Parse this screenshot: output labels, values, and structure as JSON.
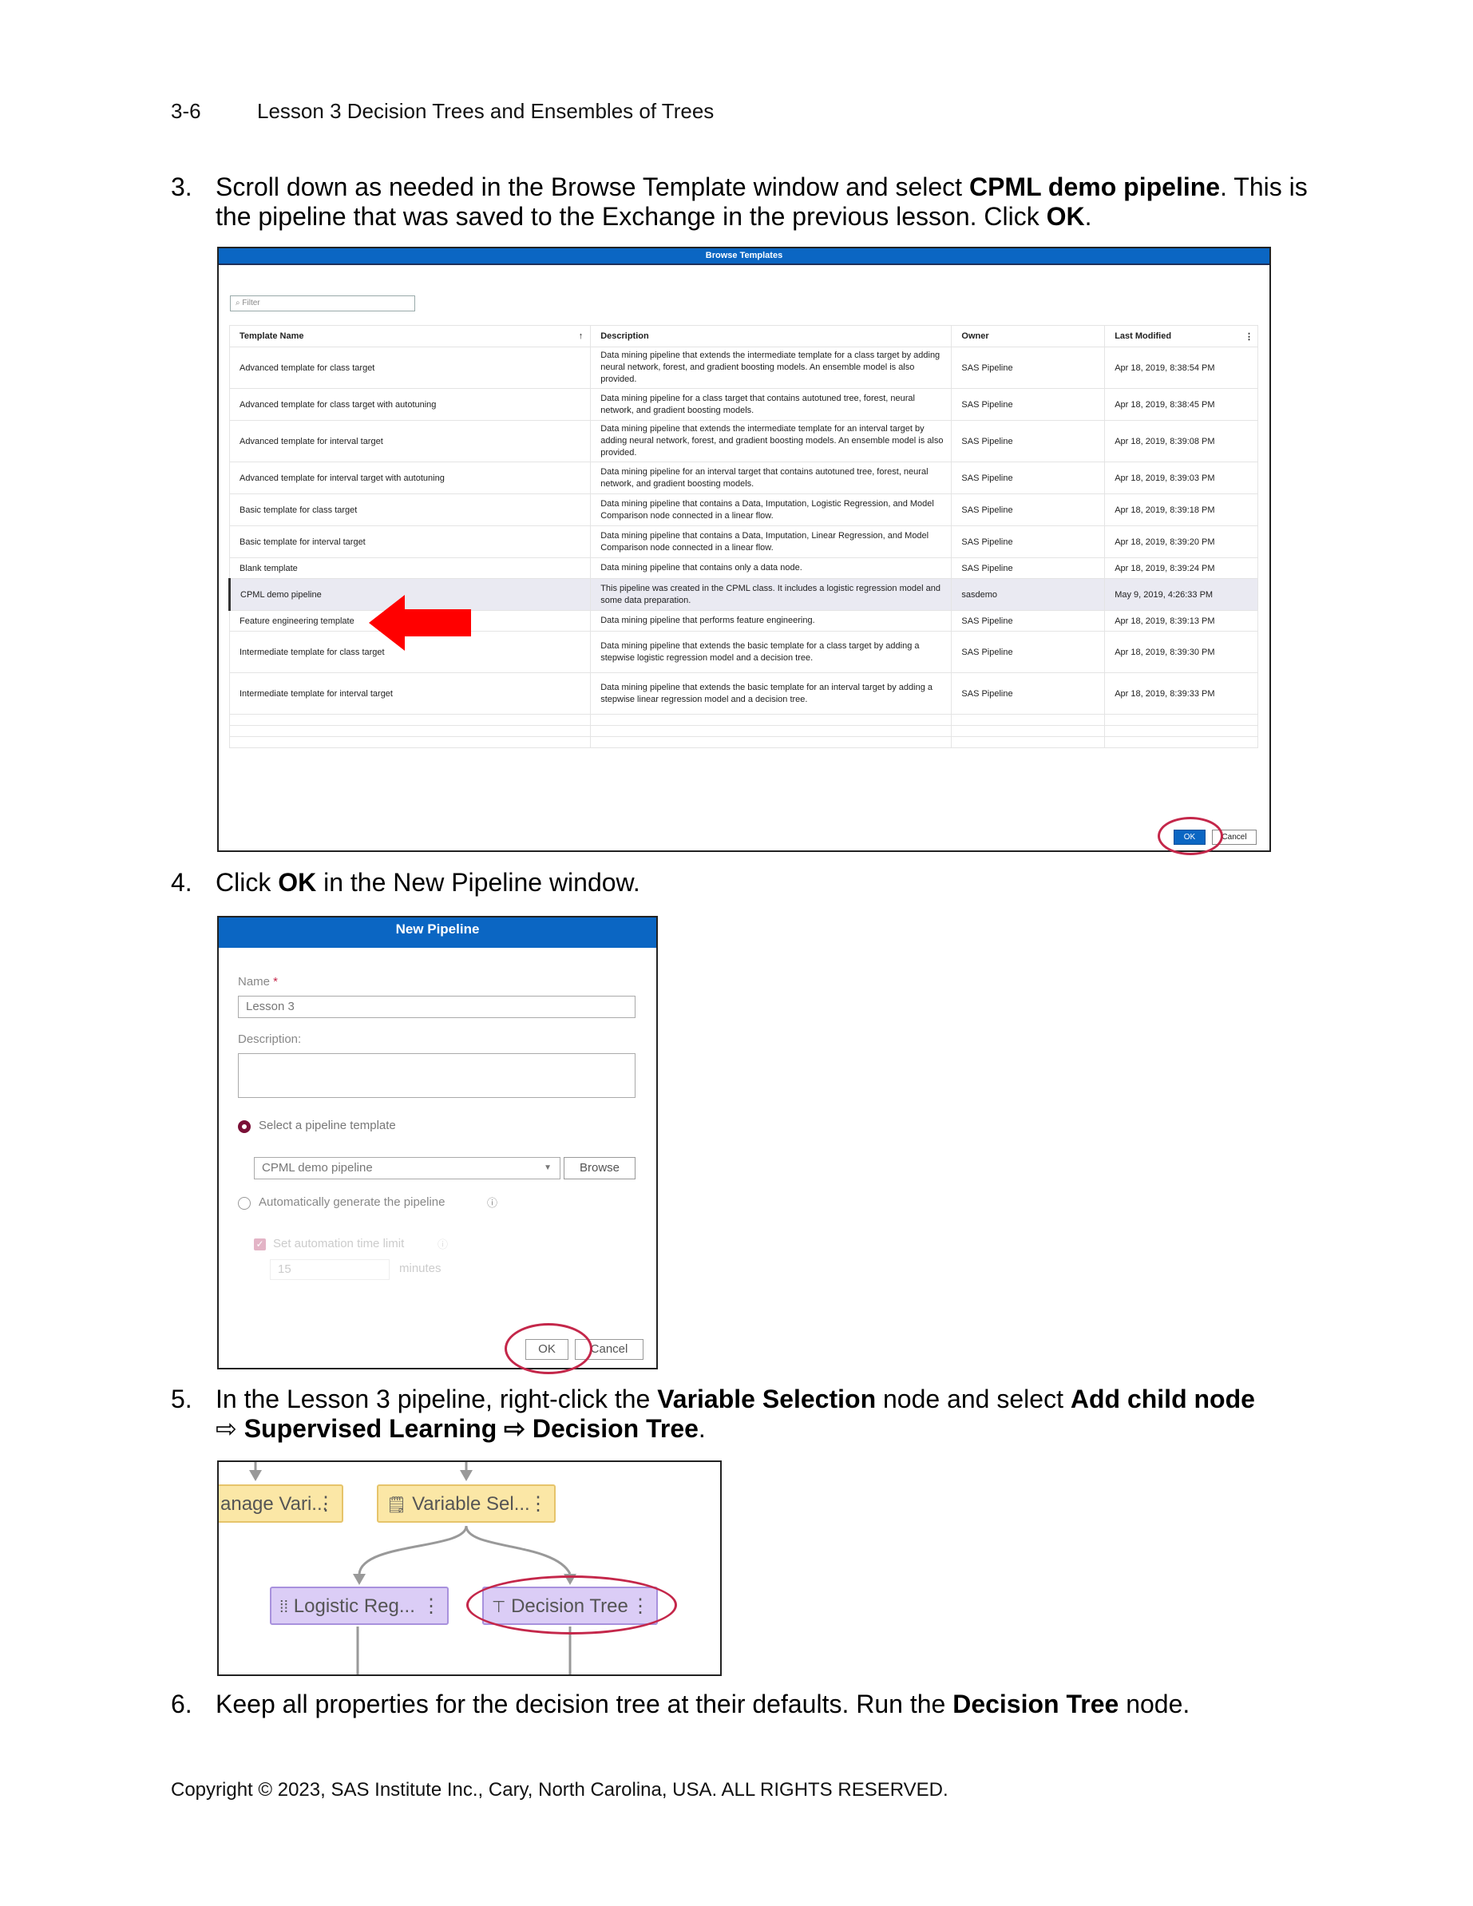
{
  "header": {
    "page_number": "3-6",
    "title": "Lesson 3  Decision Trees and Ensembles of Trees"
  },
  "steps": [
    {
      "num": "3.",
      "parts": [
        "Scroll down as needed in the Browse Template window and select ",
        "CPML demo pipeline",
        ". This is the pipeline that was saved to the Exchange in the previous lesson. Click ",
        "OK",
        "."
      ]
    },
    {
      "num": "4.",
      "parts": [
        "Click ",
        "OK",
        " in the New Pipeline window."
      ]
    },
    {
      "num": "5.",
      "parts": [
        "In the Lesson 3 pipeline, right-click the ",
        "Variable Selection",
        " node and select ",
        "Add child node",
        " ⇨ ",
        "Supervised Learning",
        " ⇨ ",
        "Decision Tree",
        "."
      ]
    },
    {
      "num": "6.",
      "parts": [
        "Keep all properties for the decision tree at their defaults. Run the ",
        "Decision Tree",
        " node."
      ]
    }
  ],
  "browse_dialog": {
    "title": "Browse Templates",
    "filter_placeholder": "Filter",
    "columns": [
      "Template Name",
      "Description",
      "Owner",
      "Last Modified"
    ],
    "rows": [
      {
        "name": "Advanced template for class target",
        "desc": "Data mining pipeline that extends the intermediate template for a class target by adding neural network, forest, and gradient boosting models. An ensemble model is also provided.",
        "owner": "SAS Pipeline",
        "modified": "Apr 18, 2019, 8:38:54 PM",
        "selected": false
      },
      {
        "name": "Advanced template for class target with autotuning",
        "desc": "Data mining pipeline for a class target that contains autotuned tree, forest, neural network, and gradient boosting models.",
        "owner": "SAS Pipeline",
        "modified": "Apr 18, 2019, 8:38:45 PM",
        "selected": false
      },
      {
        "name": "Advanced template for interval target",
        "desc": "Data mining pipeline that extends the intermediate template for an interval target by adding neural network, forest, and gradient boosting models. An ensemble model is also provided.",
        "owner": "SAS Pipeline",
        "modified": "Apr 18, 2019, 8:39:08 PM",
        "selected": false
      },
      {
        "name": "Advanced template for interval target with autotuning",
        "desc": "Data mining pipeline for an interval target that contains autotuned tree, forest, neural network, and gradient boosting models.",
        "owner": "SAS Pipeline",
        "modified": "Apr 18, 2019, 8:39:03 PM",
        "selected": false
      },
      {
        "name": "Basic template for class target",
        "desc": "Data mining pipeline that contains a Data, Imputation, Logistic Regression, and Model Comparison node connected in a linear flow.",
        "owner": "SAS Pipeline",
        "modified": "Apr 18, 2019, 8:39:18 PM",
        "selected": false
      },
      {
        "name": "Basic template for interval target",
        "desc": "Data mining pipeline that contains a Data, Imputation, Linear Regression, and Model Comparison node connected in a linear flow.",
        "owner": "SAS Pipeline",
        "modified": "Apr 18, 2019, 8:39:20 PM",
        "selected": false
      },
      {
        "name": "Blank template",
        "desc": "Data mining pipeline that contains only a data node.",
        "owner": "SAS Pipeline",
        "modified": "Apr 18, 2019, 8:39:24 PM",
        "selected": false
      },
      {
        "name": "CPML demo pipeline",
        "desc": "This pipeline was created in the CPML class. It includes a logistic regression model and some data preparation.",
        "owner": "sasdemo",
        "modified": "May 9, 2019, 4:26:33 PM",
        "selected": true
      },
      {
        "name": "Feature engineering template",
        "desc": "Data mining pipeline that performs feature engineering.",
        "owner": "SAS Pipeline",
        "modified": "Apr 18, 2019, 8:39:13 PM",
        "selected": false
      },
      {
        "name": "Intermediate template for class target",
        "desc": "Data mining pipeline that extends the basic template for a class target by adding a stepwise logistic regression model and a decision tree.",
        "owner": "SAS Pipeline",
        "modified": "Apr 18, 2019, 8:39:30 PM",
        "selected": false
      },
      {
        "name": "Intermediate template for interval target",
        "desc": "Data mining pipeline that extends the basic template for an interval target by adding a stepwise linear regression model and a decision tree.",
        "owner": "SAS Pipeline",
        "modified": "Apr 18, 2019, 8:39:33 PM",
        "selected": false
      }
    ],
    "ok_label": "OK",
    "cancel_label": "Cancel"
  },
  "new_pipeline": {
    "title": "New Pipeline",
    "name_label": "Name",
    "name_value": "Lesson 3",
    "description_label": "Description:",
    "option_template": "Select a pipeline template",
    "template_value": "CPML demo pipeline",
    "browse_label": "Browse",
    "option_auto": "Automatically generate the pipeline",
    "set_time_limit": "Set automation time limit",
    "time_value": "15",
    "time_unit": "minutes",
    "ok_label": "OK",
    "cancel_label": "Cancel"
  },
  "pipeline": {
    "node_manage": "anage Vari...",
    "node_varsel": "Variable Sel...",
    "node_logreg": "Logistic Reg...",
    "node_dtree": "Decision Tree"
  },
  "colors": {
    "accent_blue": "#0b66c3",
    "highlight_ring": "#c4274a",
    "arrow_red": "#ff0000"
  },
  "footer": {
    "copyright": "Copyright © 2023, SAS Institute Inc., Cary, North Carolina, USA. ALL RIGHTS RESERVED."
  }
}
